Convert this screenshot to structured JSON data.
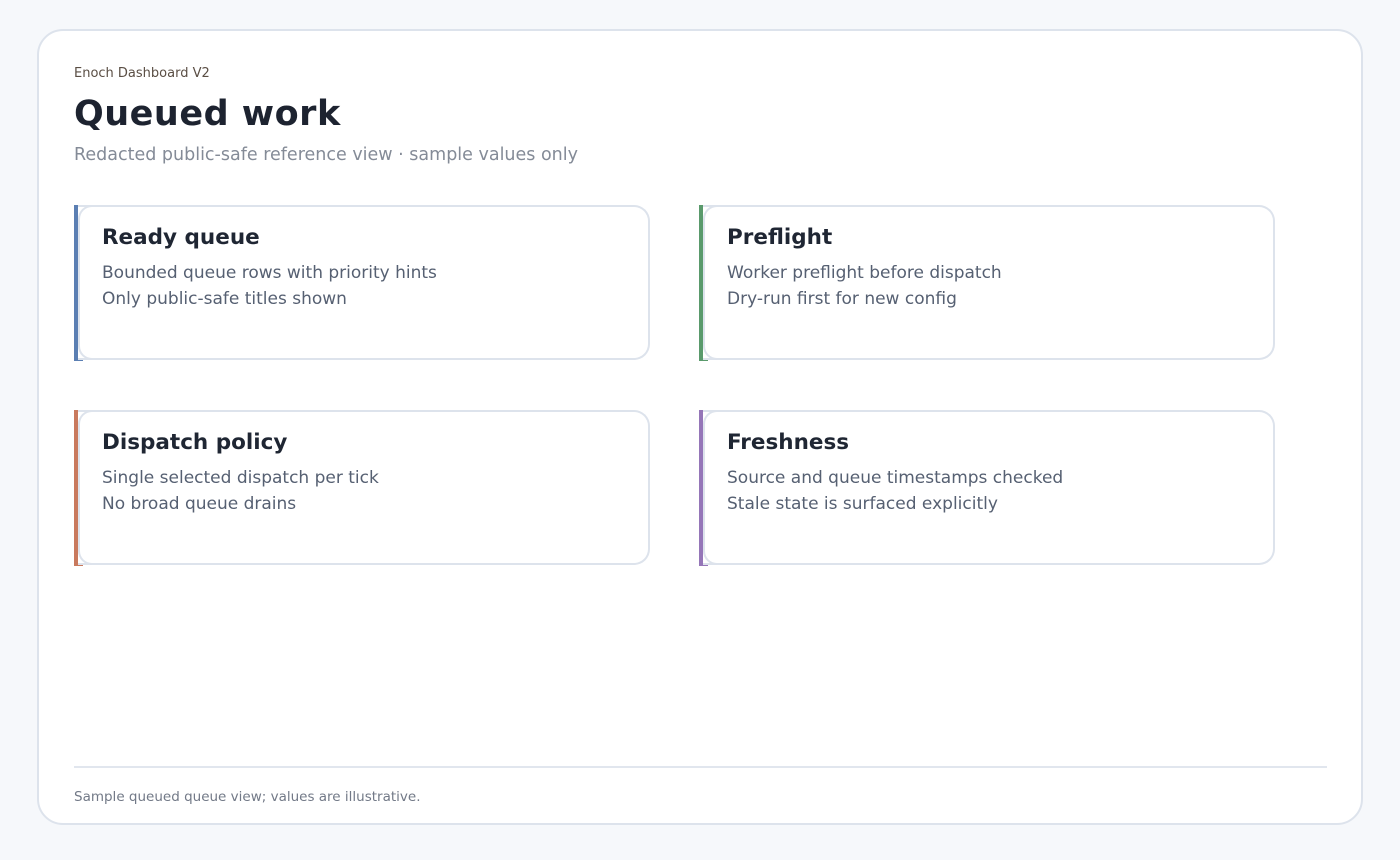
{
  "header": {
    "eyebrow": "Enoch Dashboard V2",
    "title": "Queued work",
    "subtitle": "Redacted public-safe reference view · sample values only"
  },
  "cards": [
    {
      "title": "Ready queue",
      "lines": [
        "Bounded queue rows with priority hints",
        "Only public-safe titles shown"
      ],
      "accent": "#5b7fb3"
    },
    {
      "title": "Preflight",
      "lines": [
        "Worker preflight before dispatch",
        "Dry-run first for new config"
      ],
      "accent": "#5a9a6c"
    },
    {
      "title": "Dispatch policy",
      "lines": [
        "Single selected dispatch per tick",
        "No broad queue drains"
      ],
      "accent": "#c97a5e"
    },
    {
      "title": "Freshness",
      "lines": [
        "Source and queue timestamps checked",
        "Stale state is surfaced explicitly"
      ],
      "accent": "#9576b8"
    }
  ],
  "footer": {
    "note": "Sample queued queue view; values are illustrative."
  }
}
